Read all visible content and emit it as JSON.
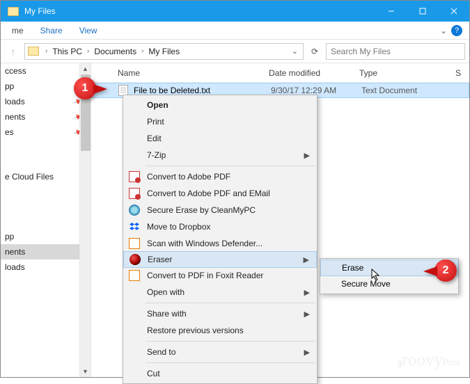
{
  "titlebar": {
    "title": "My Files"
  },
  "menubar": {
    "items": [
      "me",
      "Share",
      "View"
    ]
  },
  "breadcrumb": {
    "parts": [
      "This PC",
      "Documents",
      "My Files"
    ]
  },
  "search": {
    "placeholder": "Search My Files"
  },
  "sidebar": {
    "items": [
      {
        "label": "ccess",
        "pinned": false
      },
      {
        "label": "pp",
        "pinned": true
      },
      {
        "label": "loads",
        "pinned": true
      },
      {
        "label": "nents",
        "pinned": true
      },
      {
        "label": "es",
        "pinned": true
      },
      {
        "label": "",
        "pinned": false
      },
      {
        "label": "e Cloud Files",
        "pinned": false
      },
      {
        "label": "",
        "pinned": false
      },
      {
        "label": "",
        "pinned": false
      },
      {
        "label": "pp",
        "pinned": false
      },
      {
        "label": "nents",
        "pinned": false,
        "selected": true
      },
      {
        "label": "loads",
        "pinned": false
      }
    ]
  },
  "columns": {
    "name": "Name",
    "date": "Date modified",
    "type": "Type",
    "extra": "S"
  },
  "file": {
    "name": "File to be Deleted.txt",
    "date": "9/30/17 12:29 AM",
    "type": "Text Document"
  },
  "context_menu": {
    "items": [
      {
        "label": "Open",
        "bold": true
      },
      {
        "label": "Print"
      },
      {
        "label": "Edit"
      },
      {
        "label": "7-Zip",
        "submenu": true
      },
      {
        "sep": true
      },
      {
        "label": "Convert to Adobe PDF",
        "icon": "pdf"
      },
      {
        "label": "Convert to Adobe PDF and EMail",
        "icon": "pdf"
      },
      {
        "label": "Secure Erase by CleanMyPC",
        "icon": "secure"
      },
      {
        "label": "Move to Dropbox",
        "icon": "dropbox"
      },
      {
        "label": "Scan with Windows Defender...",
        "icon": "defender"
      },
      {
        "label": "Eraser",
        "icon": "eraser",
        "submenu": true,
        "hover": true
      },
      {
        "label": "Convert to PDF in Foxit Reader",
        "icon": "foxit"
      },
      {
        "label": "Open with",
        "submenu": true
      },
      {
        "sep": true
      },
      {
        "label": "Share with",
        "submenu": true
      },
      {
        "label": "Restore previous versions"
      },
      {
        "sep": true
      },
      {
        "label": "Send to",
        "submenu": true
      },
      {
        "sep": true
      },
      {
        "label": "Cut"
      }
    ]
  },
  "submenu": {
    "items": [
      {
        "label": "Erase",
        "hover": true
      },
      {
        "label": "Secure Move"
      }
    ]
  },
  "callouts": {
    "one": "1",
    "two": "2"
  },
  "watermark": "groovyPost"
}
